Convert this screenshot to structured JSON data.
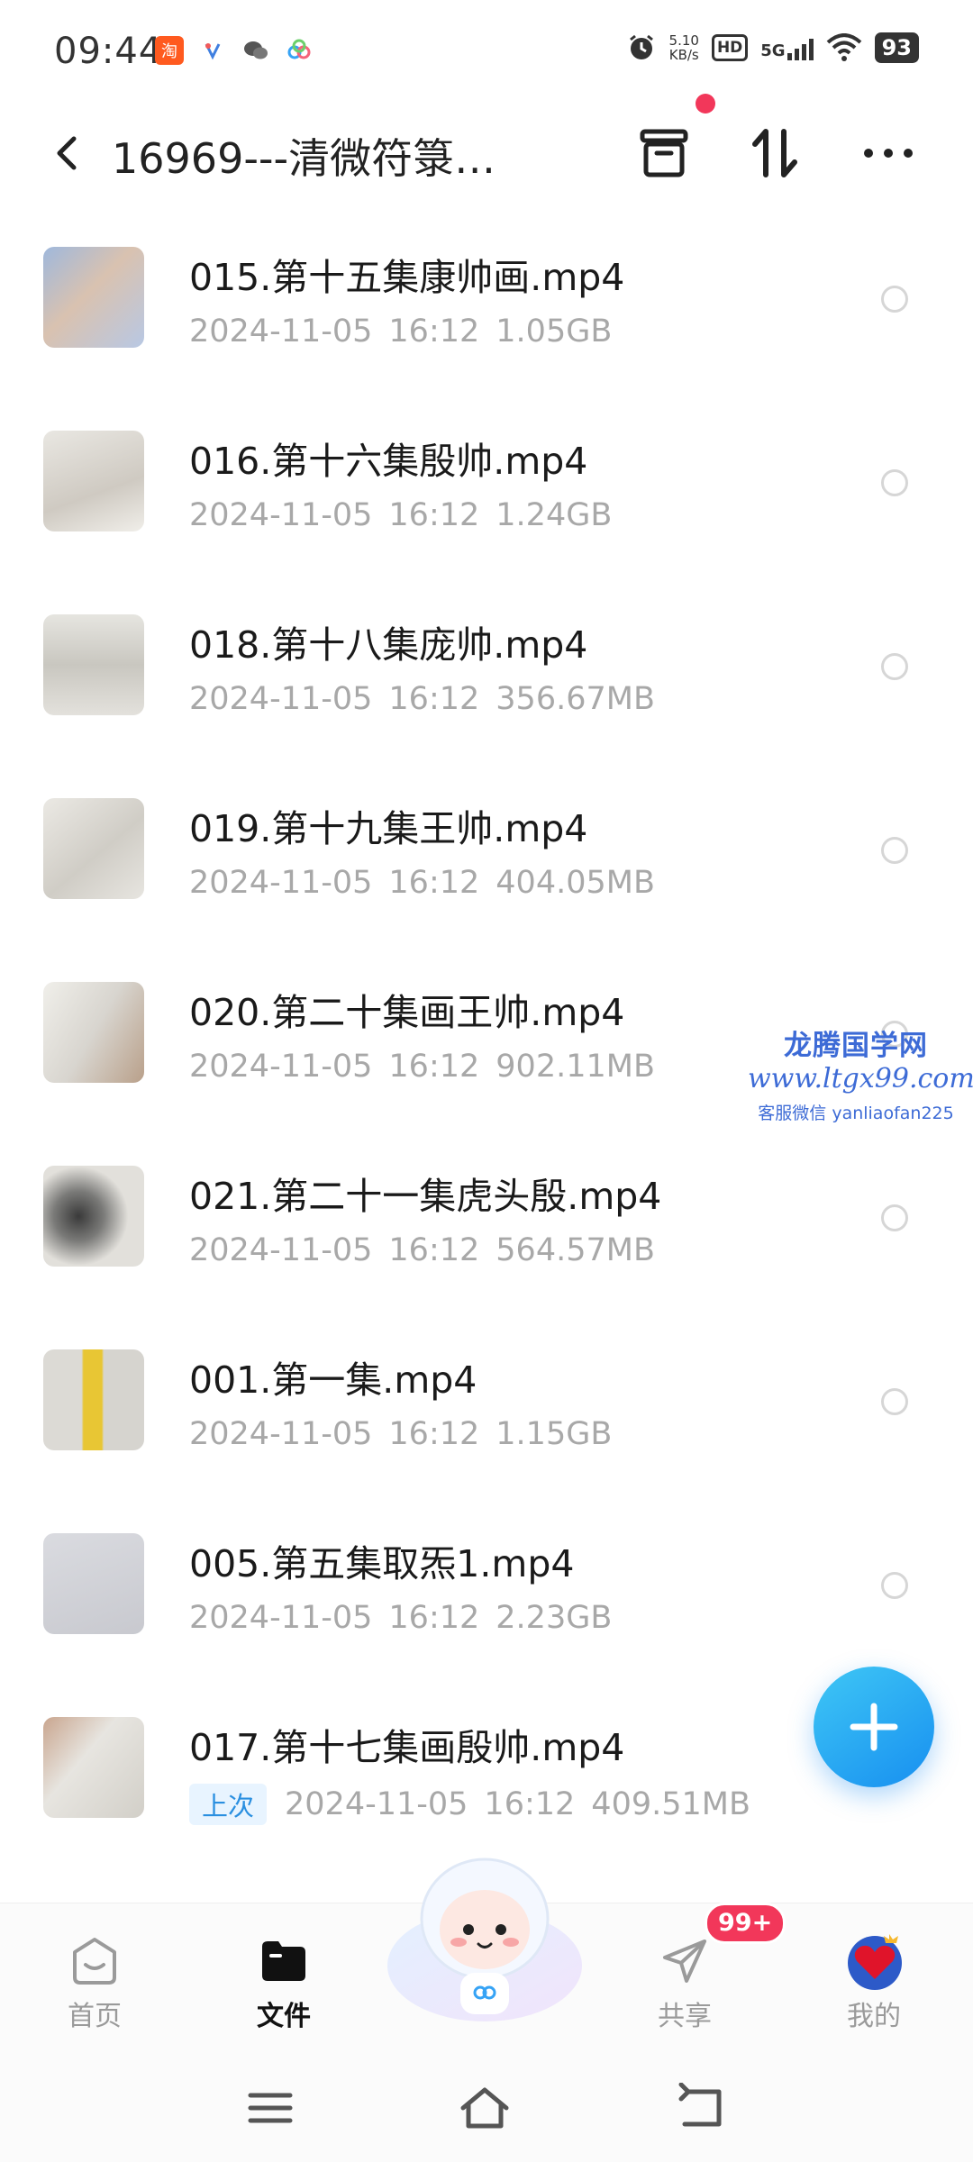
{
  "status_bar": {
    "time": "09:44",
    "network_speed_value": "5.10",
    "network_speed_unit": "KB/s",
    "hd_label": "HD",
    "network_type": "5G",
    "battery": "93",
    "app_icons": [
      "taobao-icon",
      "app-icon",
      "wechat-icon",
      "cloud-drive-icon"
    ]
  },
  "header": {
    "title": "16969---清微符箓…",
    "icons": [
      "back-icon",
      "archive-icon",
      "sort-icon",
      "more-icon"
    ],
    "notification_dot_color": "#f2375a"
  },
  "files": [
    {
      "name": "015.第十五集康帅画.mp4",
      "date": "2024-11-05",
      "time": "16:12",
      "size": "1.05GB",
      "tag": ""
    },
    {
      "name": "016.第十六集殷帅.mp4",
      "date": "2024-11-05",
      "time": "16:12",
      "size": "1.24GB",
      "tag": ""
    },
    {
      "name": "018.第十八集庞帅.mp4",
      "date": "2024-11-05",
      "time": "16:12",
      "size": "356.67MB",
      "tag": ""
    },
    {
      "name": "019.第十九集王帅.mp4",
      "date": "2024-11-05",
      "time": "16:12",
      "size": "404.05MB",
      "tag": ""
    },
    {
      "name": "020.第二十集画王帅.mp4",
      "date": "2024-11-05",
      "time": "16:12",
      "size": "902.11MB",
      "tag": ""
    },
    {
      "name": "021.第二十一集虎头殷.mp4",
      "date": "2024-11-05",
      "time": "16:12",
      "size": "564.57MB",
      "tag": ""
    },
    {
      "name": "001.第一集.mp4",
      "date": "2024-11-05",
      "time": "16:12",
      "size": "1.15GB",
      "tag": ""
    },
    {
      "name": "005.第五集取炁1.mp4",
      "date": "2024-11-05",
      "time": "16:12",
      "size": "2.23GB",
      "tag": ""
    },
    {
      "name": "017.第十七集画殷帅.mp4",
      "date": "2024-11-05",
      "time": "16:12",
      "size": "409.51MB",
      "tag": "上次"
    }
  ],
  "watermark": {
    "line1": "龙腾国学网",
    "line2": "www.ltgx99.com",
    "line3": "客服微信 yanliaofan225"
  },
  "fab": {
    "icon": "plus-icon",
    "color": "#1c9bf0"
  },
  "bottom_nav": {
    "items": [
      {
        "label": "首页",
        "icon": "home-face-icon",
        "active": false
      },
      {
        "label": "文件",
        "icon": "folder-icon",
        "active": true
      },
      {
        "label": "共享",
        "icon": "paper-plane-icon",
        "active": false
      },
      {
        "label": "我的",
        "icon": "avatar-heart-icon",
        "active": false
      }
    ],
    "share_badge": "99+",
    "center_icon": "mascot-icon"
  },
  "system_nav": {
    "icons": [
      "menu-icon",
      "home-icon",
      "back-icon"
    ]
  },
  "colors": {
    "accent": "#1c9bf0",
    "badge": "#f2375a",
    "meta_text": "#a8a8a8"
  }
}
